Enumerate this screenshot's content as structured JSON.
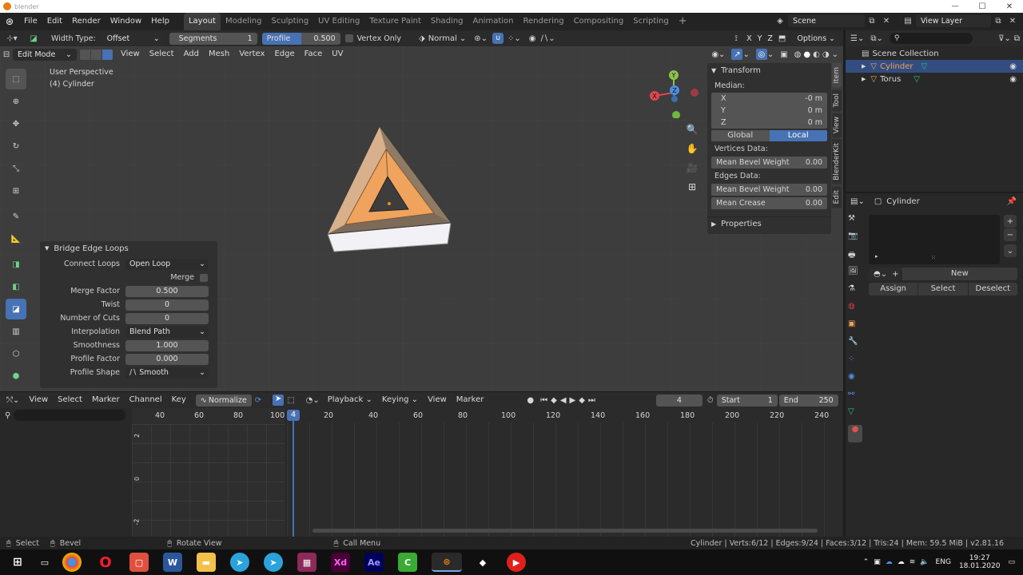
{
  "titlebar": {
    "title": "blender",
    "minimize": "—",
    "maximize": "☐",
    "close": "✕"
  },
  "menu": [
    "File",
    "Edit",
    "Render",
    "Window",
    "Help"
  ],
  "workspaces": [
    "Layout",
    "Modeling",
    "Sculpting",
    "UV Editing",
    "Texture Paint",
    "Shading",
    "Animation",
    "Rendering",
    "Compositing",
    "Scripting"
  ],
  "active_workspace": "Layout",
  "scene": {
    "label": "Scene",
    "view_layer": "View Layer"
  },
  "tool_settings": {
    "width_type_label": "Width Type:",
    "width_type_value": "Offset",
    "segments_label": "Segments",
    "segments_value": "1",
    "profile_label": "Profile",
    "profile_value": "0.500",
    "vertex_only": "Vertex Only",
    "orientation": "Normal",
    "options": "Options",
    "axis_x": "X",
    "axis_y": "Y",
    "axis_z": "Z"
  },
  "viewport_header": {
    "mode": "Edit Mode",
    "menus": [
      "View",
      "Select",
      "Add",
      "Mesh",
      "Vertex",
      "Edge",
      "Face",
      "UV"
    ]
  },
  "viewport": {
    "perspective": "User Perspective",
    "object": "(4) Cylinder"
  },
  "navigation_gizmo": {
    "x": "X",
    "y": "Y",
    "z": "Z"
  },
  "npanel": {
    "transform": "Transform",
    "median": "Median:",
    "x_label": "X",
    "x_value": "-0 m",
    "y_label": "Y",
    "y_value": "0 m",
    "z_label": "Z",
    "z_value": "0 m",
    "global": "Global",
    "local": "Local",
    "vertices_data": "Vertices Data:",
    "v_bevel_label": "Mean Bevel Weight",
    "v_bevel_value": "0.00",
    "edges_data": "Edges Data:",
    "e_bevel_label": "Mean Bevel Weight",
    "e_bevel_value": "0.00",
    "crease_label": "Mean Crease",
    "crease_value": "0.00",
    "properties": "Properties",
    "tabs": [
      "Item",
      "Tool",
      "View",
      "BlenderKit",
      "Edit"
    ]
  },
  "last_operator": {
    "title": "Bridge Edge Loops",
    "connect_loops_label": "Connect Loops",
    "connect_loops_value": "Open Loop",
    "merge_label": "Merge",
    "merge_factor_label": "Merge Factor",
    "merge_factor_value": "0.500",
    "twist_label": "Twist",
    "twist_value": "0",
    "cuts_label": "Number of Cuts",
    "cuts_value": "0",
    "interp_label": "Interpolation",
    "interp_value": "Blend Path",
    "smooth_label": "Smoothness",
    "smooth_value": "1.000",
    "profile_factor_label": "Profile Factor",
    "profile_factor_value": "0.000",
    "profile_shape_label": "Profile Shape",
    "profile_shape_value": "Smooth"
  },
  "outliner": {
    "collection": "Scene Collection",
    "items": [
      "Cylinder",
      "Torus"
    ]
  },
  "properties": {
    "object": "Cylinder",
    "new": "New",
    "assign": "Assign",
    "select": "Select",
    "deselect": "Deselect"
  },
  "timeline": {
    "menus": [
      "View",
      "Select",
      "Marker",
      "Channel",
      "Key"
    ],
    "normalize": "Normalize",
    "playback": "Playback",
    "keying": "Keying",
    "view": "View",
    "marker": "Marker",
    "current_frame": "4",
    "start_label": "Start",
    "start_value": "1",
    "end_label": "End",
    "end_value": "250",
    "left_ticks": [
      "40",
      "60",
      "80",
      "100"
    ],
    "right_ticks": [
      "20",
      "40",
      "60",
      "80",
      "100",
      "120",
      "140",
      "160",
      "180",
      "200",
      "220",
      "240"
    ],
    "frame_marker": "4",
    "y_ticks": [
      "2",
      "0",
      "-2"
    ]
  },
  "statusbar": {
    "select": "Select",
    "bevel": "Bevel",
    "rotate": "Rotate View",
    "call_menu": "Call Menu",
    "stats": "Cylinder | Verts:6/12 | Edges:9/24 | Faces:3/12 | Tris:24 | Mem: 59.5 MiB | v2.81.16"
  },
  "taskbar": {
    "lang": "ENG",
    "time": "19:27",
    "date": "18.01.2020",
    "apps": [
      "W",
      "Xd",
      "Ae"
    ]
  },
  "colors": {
    "accent": "#4772b3",
    "orange": "#f0a35c"
  }
}
